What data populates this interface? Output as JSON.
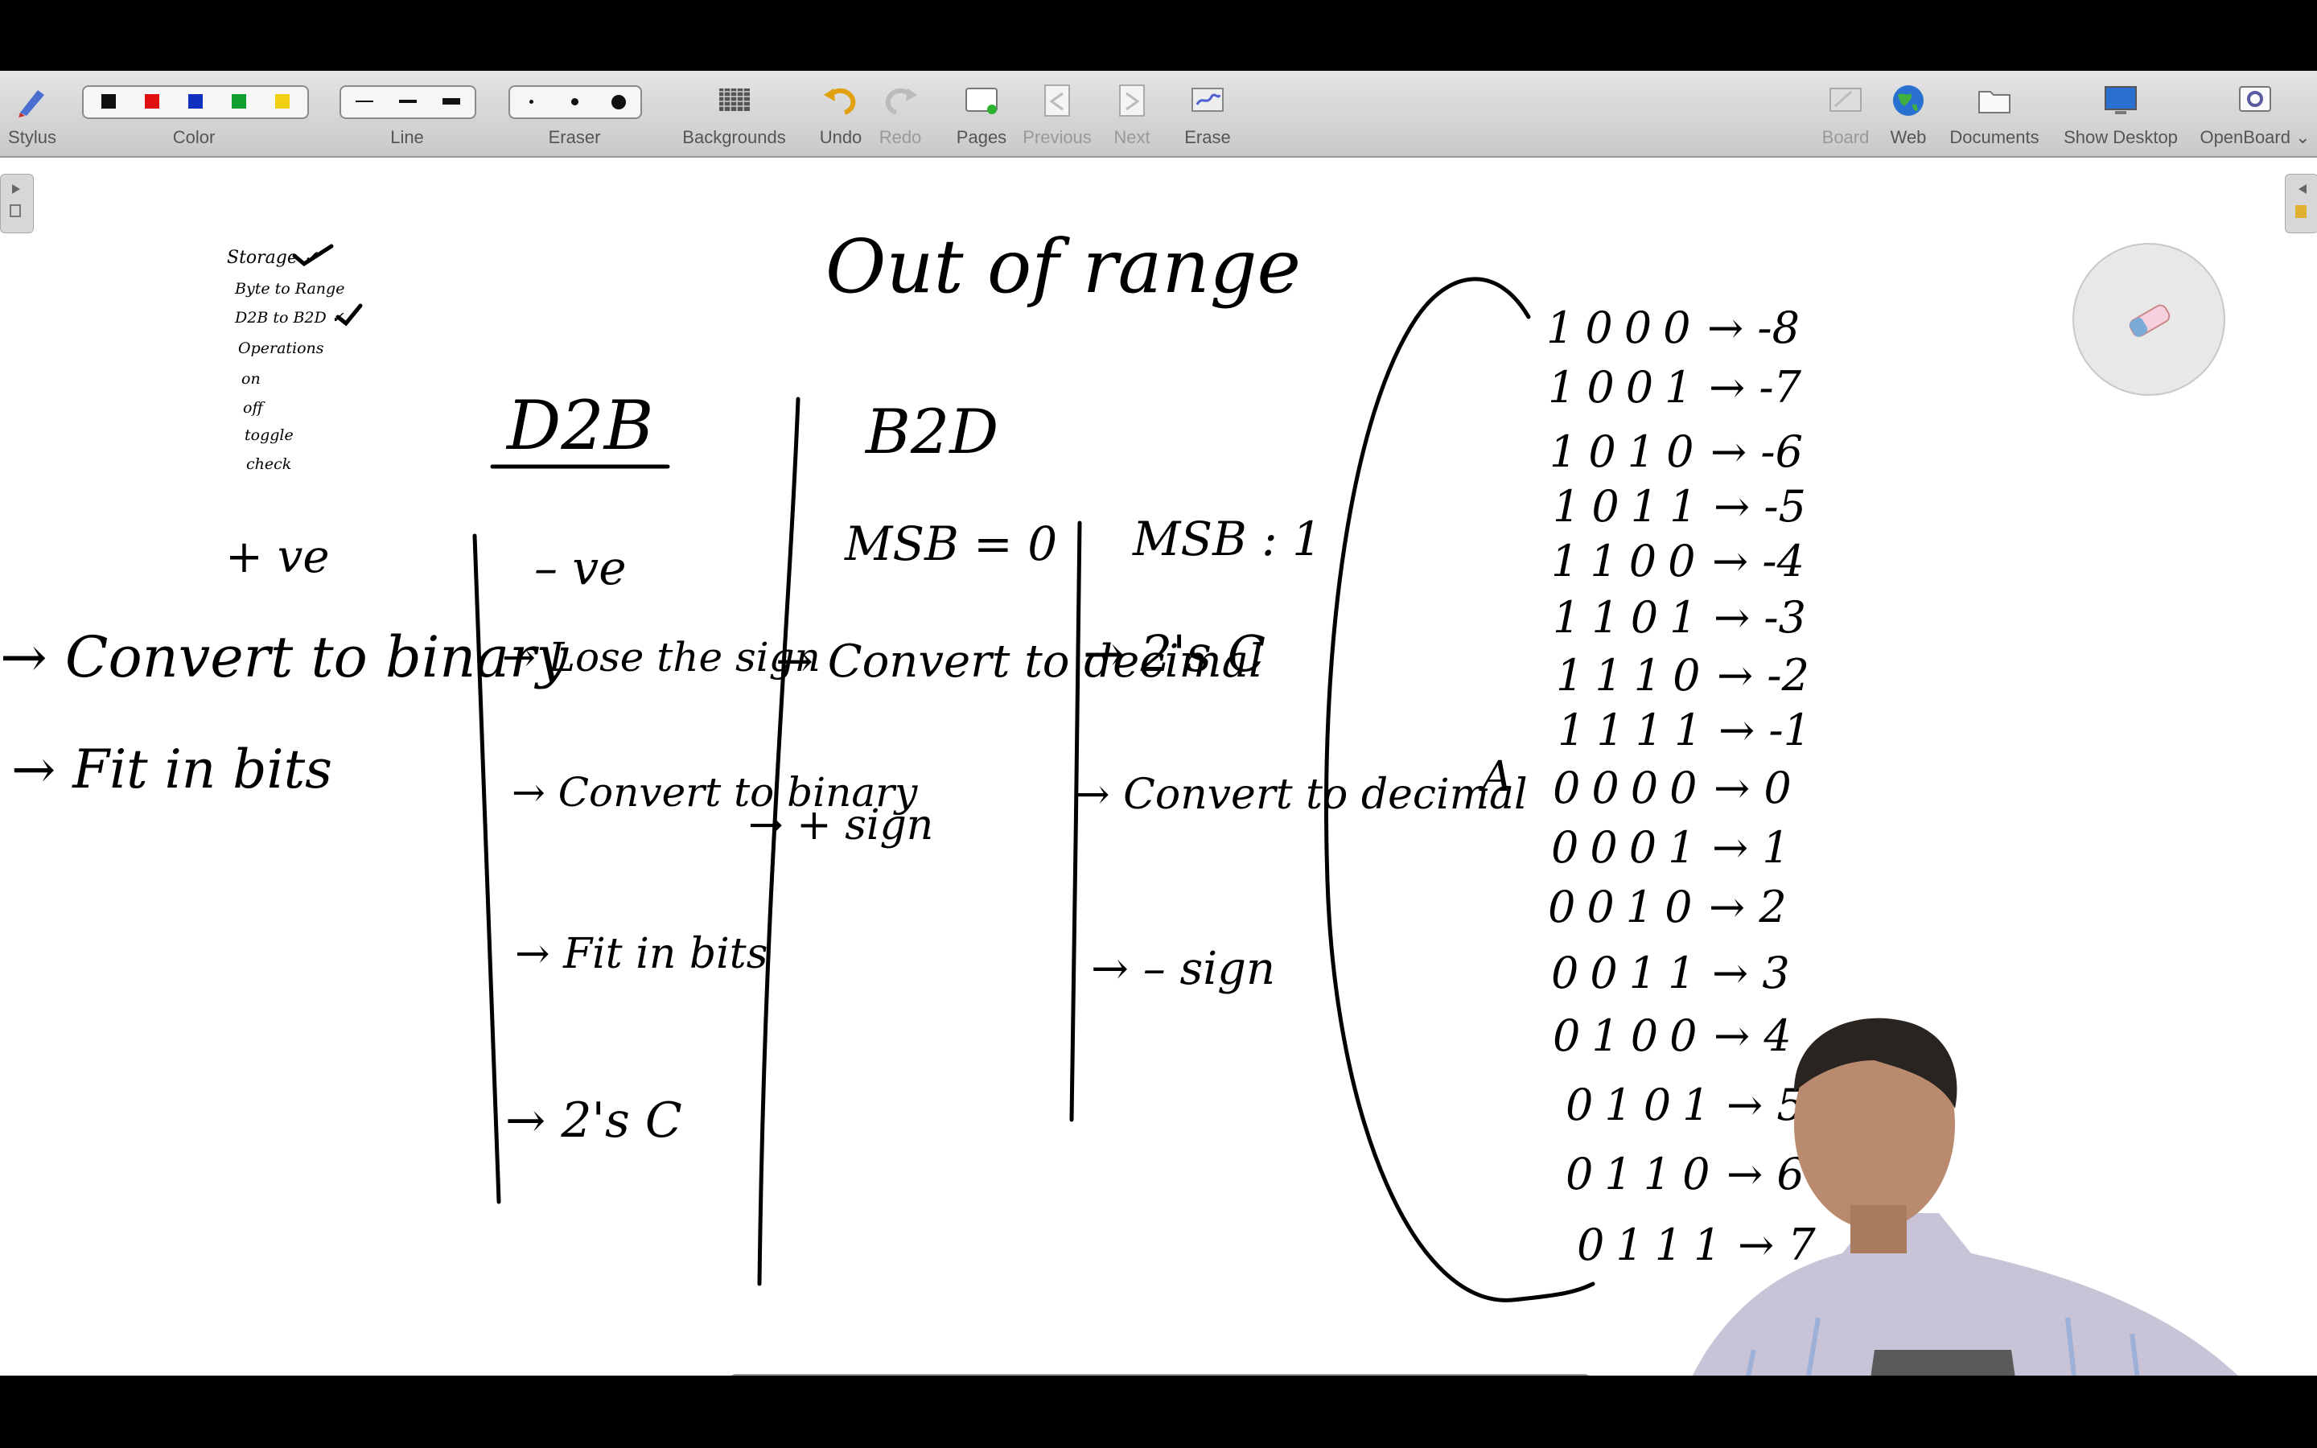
{
  "toolbar": {
    "stylus": "Stylus",
    "color": "Color",
    "line": "Line",
    "eraser": "Eraser",
    "backgrounds": "Backgrounds",
    "undo": "Undo",
    "redo": "Redo",
    "pages": "Pages",
    "previous": "Previous",
    "next": "Next",
    "erase": "Erase",
    "board": "Board",
    "web": "Web",
    "documents": "Documents",
    "show_desktop": "Show Desktop",
    "openboard": "OpenBoard ⌄"
  },
  "colors": {
    "black": "#111111",
    "red": "#e01010",
    "blue": "#1030c0",
    "green": "#10a030",
    "yellow": "#f0d010"
  },
  "board": {
    "notes": [
      "Storage ✓",
      "Byte to Range",
      "D2B to B2D ✓",
      "Operations",
      "on",
      "off",
      "toggle",
      "check"
    ],
    "title": "Out of range",
    "d2b": "D2B",
    "b2d": "B2D",
    "pos": "+ ve",
    "pos_steps": [
      "→ Convert to binary",
      "→ Fit in bits"
    ],
    "neg": "– ve",
    "neg_steps": [
      "→ Lose the sign",
      "→ Convert to binary",
      "→ Fit in bits",
      "→ 2's C"
    ],
    "msb0": "MSB = 0",
    "msb0_steps": [
      "→ Convert to decimal",
      "→ + sign"
    ],
    "msb1": "MSB : 1",
    "msb1_steps": [
      "→ 2's C",
      "→ Convert to decimal",
      "→ – sign"
    ],
    "table": [
      {
        "bits": "1000",
        "val": "→ -8"
      },
      {
        "bits": "1001",
        "val": "→ -7"
      },
      {
        "bits": "1010",
        "val": "→ -6"
      },
      {
        "bits": "1011",
        "val": "→ -5"
      },
      {
        "bits": "1100",
        "val": "→ -4"
      },
      {
        "bits": "1101",
        "val": "→ -3"
      },
      {
        "bits": "1110",
        "val": "→ -2"
      },
      {
        "bits": "1111",
        "val": "→ -1"
      },
      {
        "bits": "0000",
        "val": "→ 0"
      },
      {
        "bits": "0001",
        "val": "→ 1"
      },
      {
        "bits": "0010",
        "val": "→ 2"
      },
      {
        "bits": "0011",
        "val": "→ 3"
      },
      {
        "bits": "0100",
        "val": "→ 4"
      },
      {
        "bits": "0101",
        "val": "→ 5"
      },
      {
        "bits": "0110",
        "val": "→ 6"
      },
      {
        "bits": "0111",
        "val": "→ 7"
      }
    ],
    "star": "A"
  }
}
